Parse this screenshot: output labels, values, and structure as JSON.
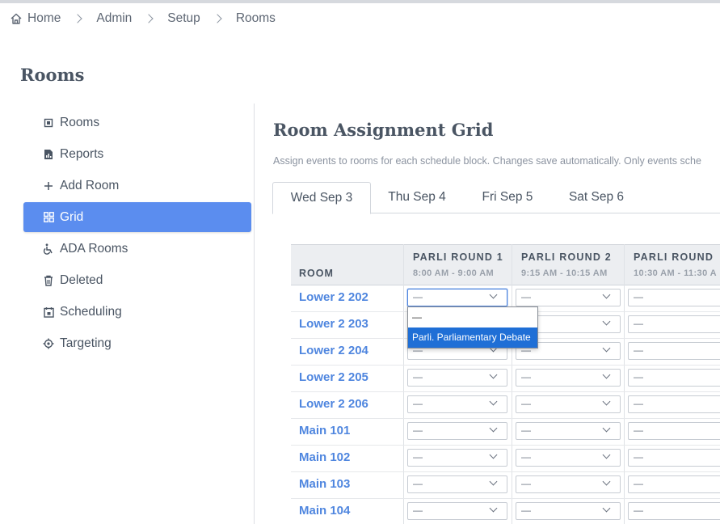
{
  "breadcrumb": [
    "Home",
    "Admin",
    "Setup",
    "Rooms"
  ],
  "page_title": "Rooms",
  "sidebar": {
    "items": [
      {
        "label": "Rooms",
        "icon": "square-dot-icon",
        "active": false
      },
      {
        "label": "Reports",
        "icon": "file-chart-icon",
        "active": false
      },
      {
        "label": "Add Room",
        "icon": "plus-icon",
        "active": false
      },
      {
        "label": "Grid",
        "icon": "grid-icon",
        "active": true
      },
      {
        "label": "ADA Rooms",
        "icon": "wheelchair-icon",
        "active": false
      },
      {
        "label": "Deleted",
        "icon": "trash-icon",
        "active": false
      },
      {
        "label": "Scheduling",
        "icon": "calendar-icon",
        "active": false
      },
      {
        "label": "Targeting",
        "icon": "target-icon",
        "active": false
      }
    ]
  },
  "main": {
    "title": "Room Assignment Grid",
    "subtitle": "Assign events to rooms for each schedule block. Changes save automatically. Only events sche",
    "tabs": [
      {
        "label": "Wed Sep 3",
        "active": true
      },
      {
        "label": "Thu Sep 4",
        "active": false
      },
      {
        "label": "Fri Sep 5",
        "active": false
      },
      {
        "label": "Sat Sep 6",
        "active": false
      }
    ]
  },
  "grid": {
    "room_header": "ROOM",
    "columns": [
      {
        "title": "PARLI ROUND 1",
        "time": "8:00 AM - 9:00 AM"
      },
      {
        "title": "PARLI ROUND 2",
        "time": "9:15 AM - 10:15 AM"
      },
      {
        "title": "PARLI ROUND",
        "time": "10:30 AM - 11:30 A"
      }
    ],
    "rooms": [
      "Lower 2 202",
      "Lower 2 203",
      "Lower 2 204",
      "Lower 2 205",
      "Lower 2 206",
      "Main 101",
      "Main 102",
      "Main 103",
      "Main 104"
    ],
    "empty_value": "—"
  },
  "dropdown": {
    "options": [
      "—",
      "Parli. Parliamentary Debate"
    ],
    "highlighted_index": 1
  },
  "colors": {
    "accent": "#5b8def",
    "link": "#4f86df",
    "highlight": "#1f6fd6"
  }
}
